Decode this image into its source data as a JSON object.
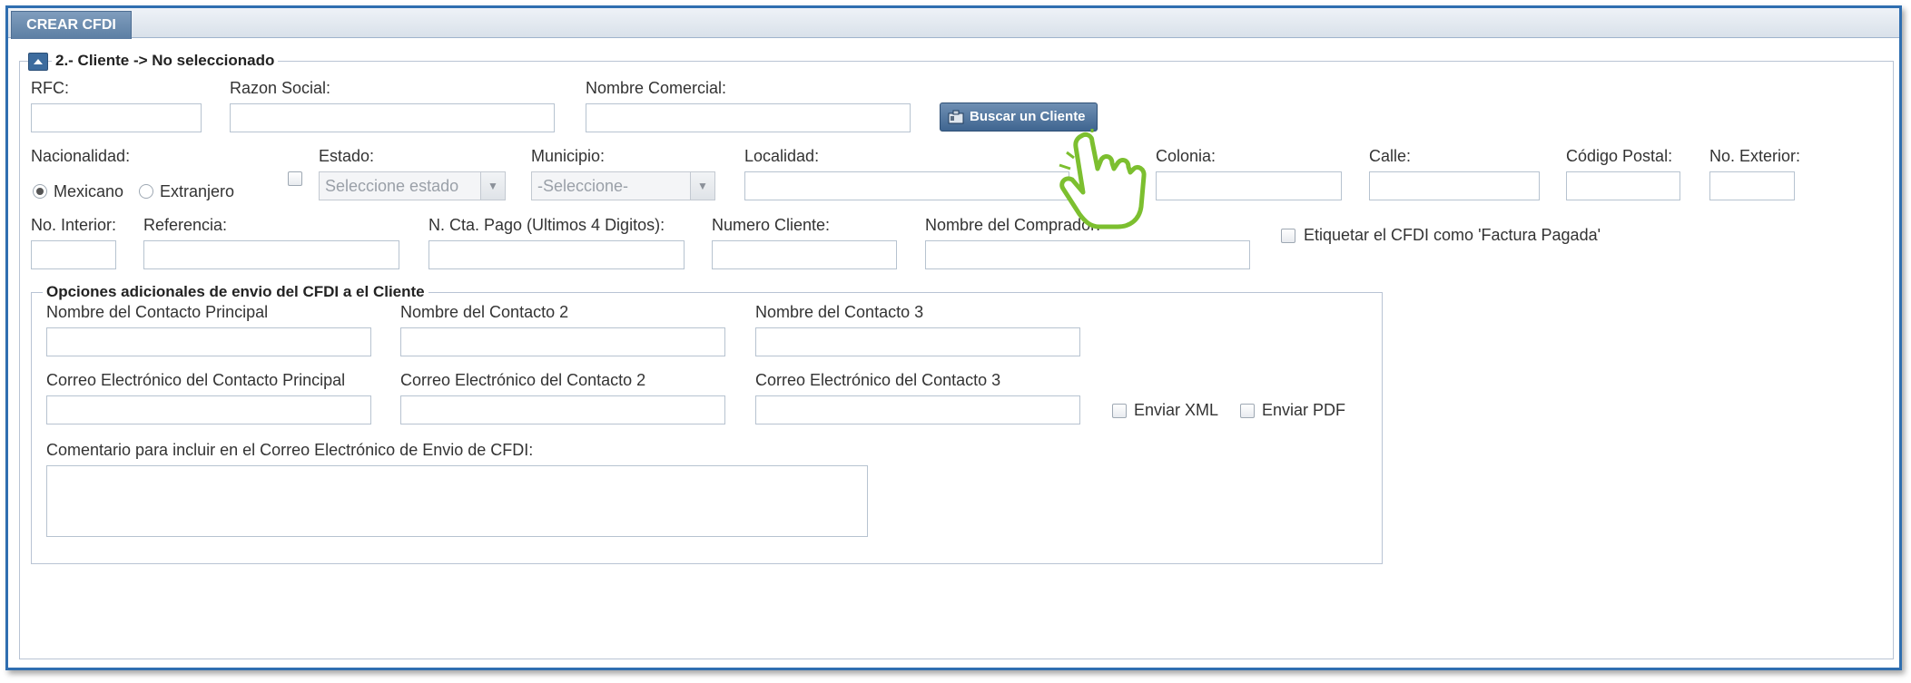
{
  "tab": {
    "label": "CREAR CFDI"
  },
  "section": {
    "title": "2.- Cliente -> No seleccionado"
  },
  "labels": {
    "rfc": "RFC:",
    "razon_social": "Razon Social:",
    "nombre_comercial": "Nombre Comercial:",
    "nacionalidad": "Nacionalidad:",
    "estado": "Estado:",
    "municipio": "Municipio:",
    "localidad": "Localidad:",
    "colonia": "Colonia:",
    "calle": "Calle:",
    "codigo_postal": "Código Postal:",
    "no_exterior": "No. Exterior:",
    "no_interior": "No. Interior:",
    "referencia": "Referencia:",
    "cta_pago": "N. Cta. Pago (Ultimos 4 Digitos):",
    "numero_cliente": "Numero Cliente:",
    "nombre_comprador": "Nombre del Comprador:"
  },
  "buttons": {
    "buscar_cliente": "Buscar un Cliente"
  },
  "nacionalidad_options": {
    "mexicano": "Mexicano",
    "extranjero": "Extranjero",
    "selected": "Mexicano"
  },
  "selects": {
    "estado_placeholder": "Seleccione estado",
    "municipio_placeholder": "-Seleccione-"
  },
  "etiquetar_label": "Etiquetar el CFDI como 'Factura Pagada'",
  "envio": {
    "legend": "Opciones adicionales de envio del CFDI a el Cliente",
    "contacto_principal": "Nombre del Contacto Principal",
    "contacto_2": "Nombre del Contacto 2",
    "contacto_3": "Nombre del Contacto 3",
    "correo_principal": "Correo Electrónico del Contacto Principal",
    "correo_2": "Correo Electrónico del Contacto 2",
    "correo_3": "Correo Electrónico del Contacto 3",
    "enviar_xml": "Enviar XML",
    "enviar_pdf": "Enviar PDF",
    "comentario": "Comentario para incluir en el Correo Electrónico de Envio de CFDI:"
  },
  "icons": {
    "collapse": "collapse-up-icon",
    "search_client": "client-card-icon",
    "cursor": "hand-pointer-icon",
    "select_arrow": "chevron-down-icon"
  }
}
